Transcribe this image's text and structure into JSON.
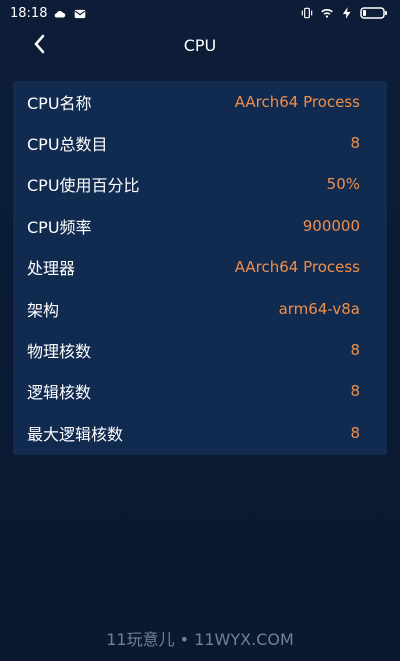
{
  "status_bar": {
    "time": "18:18",
    "left_icons": [
      "cloud-icon",
      "mail-icon"
    ],
    "right_icons": [
      "vibrate-icon",
      "wifi-icon",
      "charging-icon",
      "battery-icon"
    ]
  },
  "header": {
    "title": "CPU",
    "back_icon": "chevron-left-icon"
  },
  "cpu_info": {
    "rows": [
      {
        "label": "CPU名称",
        "value": "AArch64 Process"
      },
      {
        "label": "CPU总数目",
        "value": "8"
      },
      {
        "label": "CPU使用百分比",
        "value": "50%"
      },
      {
        "label": "CPU频率",
        "value": "900000"
      },
      {
        "label": "处理器",
        "value": "AArch64 Process"
      },
      {
        "label": "架构",
        "value": "arm64-v8a"
      },
      {
        "label": "物理核数",
        "value": "8"
      },
      {
        "label": "逻辑核数",
        "value": "8"
      },
      {
        "label": "最大逻辑核数",
        "value": "8"
      }
    ]
  },
  "watermark": {
    "text": "11玩意儿 • 11WYX.COM"
  },
  "colors": {
    "background": "#0b1a33",
    "card": "#112a4f",
    "label": "#ffffff",
    "value": "#ef8f4a",
    "watermark": "#6f809a"
  }
}
